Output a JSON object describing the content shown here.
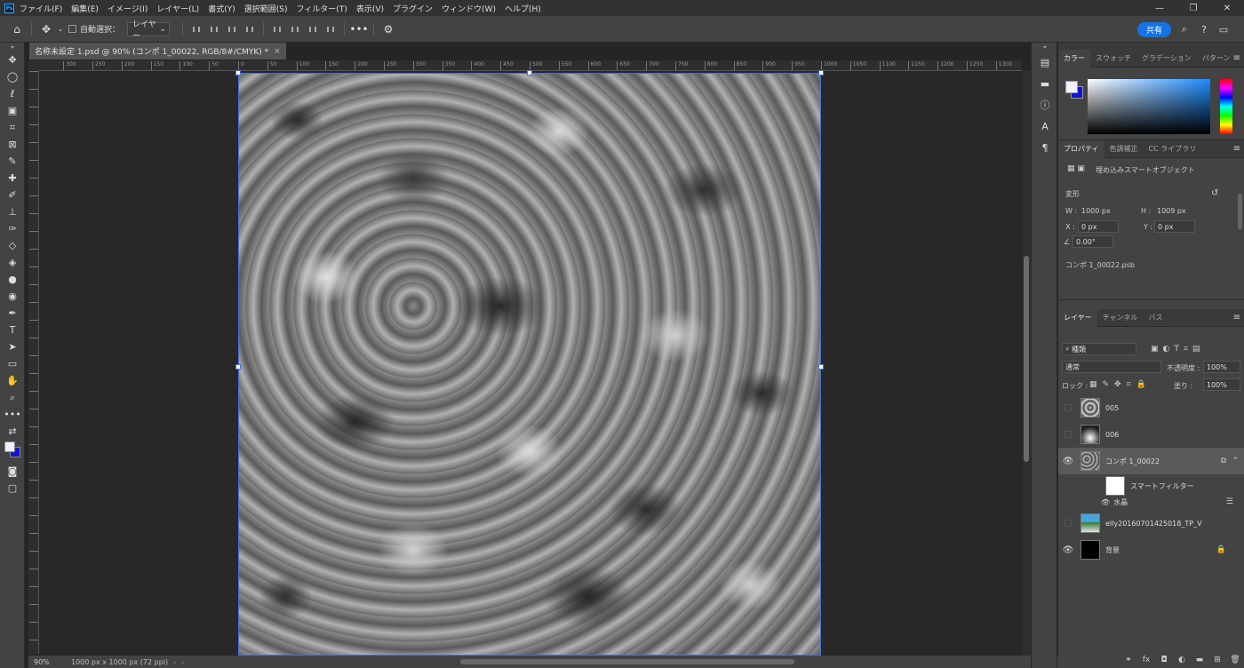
{
  "menubar": {
    "items": [
      "ファイル(F)",
      "編集(E)",
      "イメージ(I)",
      "レイヤー(L)",
      "書式(Y)",
      "選択範囲(S)",
      "フィルター(T)",
      "表示(V)",
      "プラグイン",
      "ウィンドウ(W)",
      "ヘルプ(H)"
    ],
    "logo": "Ps"
  },
  "options": {
    "auto_select_label": "自動選択：",
    "layer_dropdown": "レイヤー",
    "share_label": "共有"
  },
  "document": {
    "tab_title": "名称未設定 1.psd @ 90% (コンポ 1_00022, RGB/8#/CMYK) *",
    "zoom": "90%",
    "size_info": "1000 px x 1000 px (72 ppi)",
    "h_ruler_ticks": [
      "0",
      "50",
      "100",
      "150",
      "200",
      "250",
      "300",
      "350",
      "400",
      "450",
      "500",
      "550",
      "600",
      "650",
      "700",
      "750",
      "800",
      "850",
      "900",
      "950",
      "1000",
      "1050",
      "1100",
      "1150",
      "1200",
      "1250",
      "1300"
    ],
    "h_ruler_neg_ticks": [
      "300",
      "250",
      "200",
      "150",
      "100",
      "50"
    ]
  },
  "color_panel": {
    "tabs": [
      "カラー",
      "スウォッチ",
      "グラデーション",
      "パターン"
    ]
  },
  "properties": {
    "tabs": [
      "プロパティ",
      "色調補正",
      "CC ライブラリ"
    ],
    "type_label": "埋め込みスマートオブジェクト",
    "transform_label": "変形",
    "w_label": "W :",
    "w_value": "1000 px",
    "h_label": "H :",
    "h_value": "1009 px",
    "x_label": "X :",
    "x_value": "0 px",
    "y_label": "Y :",
    "y_value": "0 px",
    "angle_value": "0.00°",
    "file_name": "コンポ 1_00022.psb"
  },
  "layers": {
    "tabs": [
      "レイヤー",
      "チャンネル",
      "パス"
    ],
    "filter_label": "種類",
    "blend_mode": "通常",
    "opacity_label": "不透明度 :",
    "opacity_value": "100%",
    "lock_label": "ロック :",
    "fill_label": "塗り :",
    "fill_value": "100%",
    "items": [
      {
        "name": "005"
      },
      {
        "name": "006"
      },
      {
        "name": "コンポ 1_00022"
      },
      {
        "name": "スマートフィルター"
      },
      {
        "name": "水晶"
      },
      {
        "name": "elly20160701425018_TP_V"
      },
      {
        "name": "背景"
      }
    ]
  },
  "colors": {
    "accent": "#1473e6",
    "selection_border": "#4a6fd0"
  }
}
